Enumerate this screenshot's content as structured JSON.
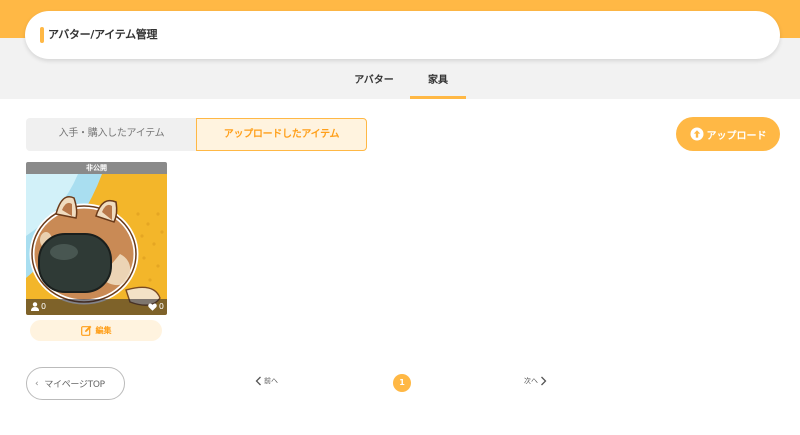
{
  "header": {
    "title": "アバター/アイテム管理"
  },
  "tabs": [
    {
      "label": "アバター"
    },
    {
      "label": "家具"
    }
  ],
  "segments": {
    "purchased_label": "入手・購入したアイテム",
    "uploaded_label": "アップロードしたアイテム"
  },
  "upload_button": {
    "label": "アップロード",
    "icon": "upload-arrow-icon"
  },
  "items": [
    {
      "status": "非公開",
      "users_count": "0",
      "likes_count": "0",
      "edit_label": "編集"
    }
  ],
  "footer": {
    "mypage_label": "マイページTOP",
    "prev_label": "前へ",
    "next_label": "次へ",
    "current_page": "1"
  },
  "colors": {
    "accent": "#ffb845",
    "accent_text": "#ff9f1a",
    "accent_light": "#fff3df",
    "band_gray": "#f2f2f2"
  }
}
